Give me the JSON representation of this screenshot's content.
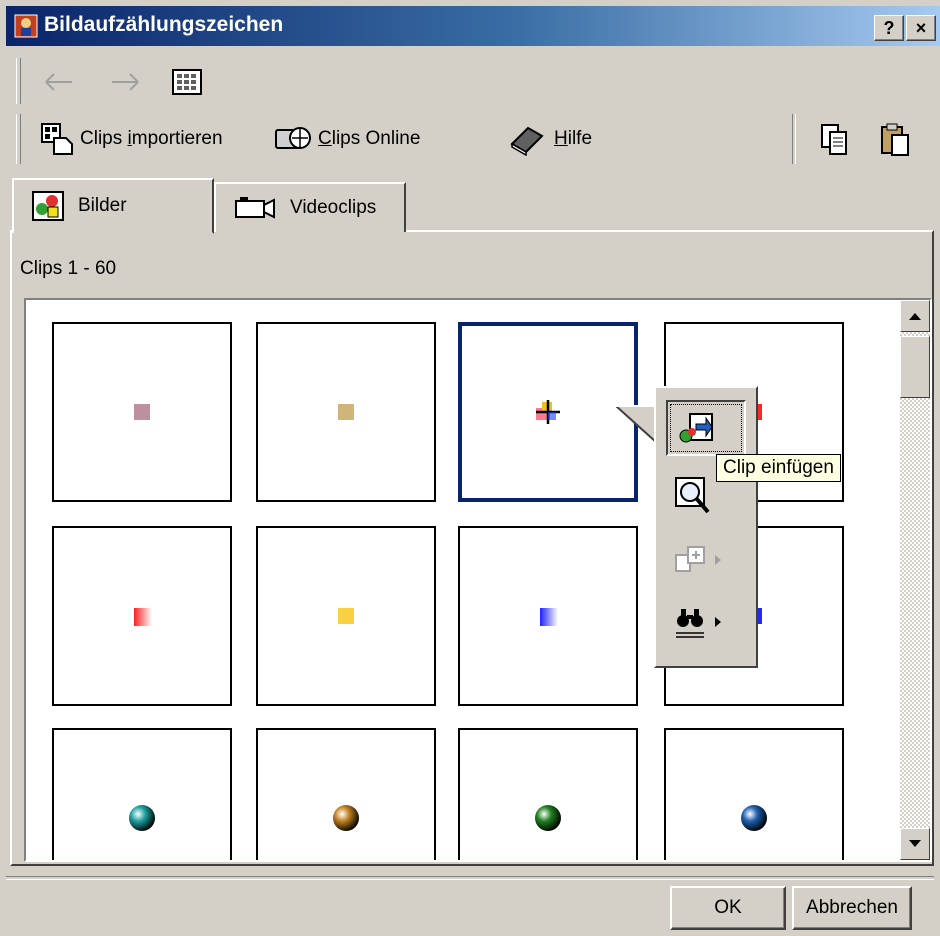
{
  "window": {
    "title": "Bildaufzählungszeichen",
    "help_btn": "?",
    "close_btn": "×"
  },
  "toolbar": {
    "back_icon": "back-arrow-icon",
    "forward_icon": "forward-arrow-icon",
    "view_icon": "thumbnail-view-icon",
    "import": {
      "prefix": "Clips ",
      "underlined": "i",
      "suffix": "mportieren"
    },
    "online": {
      "underlined": "C",
      "suffix": "lips Online"
    },
    "help": {
      "underlined": "H",
      "suffix": "ilfe"
    },
    "copy_icon": "copy-icon",
    "paste_icon": "paste-icon"
  },
  "tabs": [
    {
      "label": "Bilder",
      "icon": "pictures-icon",
      "active": true
    },
    {
      "label": "Videoclips",
      "icon": "camera-icon",
      "active": false
    }
  ],
  "clips_count": "Clips 1 - 60",
  "clips": [
    {
      "kind": "square",
      "color": "#b07c8c",
      "selected": false
    },
    {
      "kind": "square",
      "color": "#c8a860",
      "selected": false
    },
    {
      "kind": "cross",
      "color": "#ff4060",
      "selected": true
    },
    {
      "kind": "square",
      "color": "#ff0000",
      "selected": false
    },
    {
      "kind": "gradient",
      "color": "#ff2020",
      "selected": false
    },
    {
      "kind": "square",
      "color": "#f8c820",
      "selected": false
    },
    {
      "kind": "gradient",
      "color": "#2020ff",
      "selected": false
    },
    {
      "kind": "square",
      "color": "#0000ff",
      "selected": false
    },
    {
      "kind": "ball",
      "color": "#20a0a0",
      "selected": false
    },
    {
      "kind": "ball",
      "color": "#c08020",
      "selected": false
    },
    {
      "kind": "ball",
      "color": "#208020",
      "selected": false
    },
    {
      "kind": "ball",
      "color": "#2060b0",
      "selected": false
    }
  ],
  "popup": {
    "insert_icon": "insert-clip-icon",
    "preview_icon": "preview-clip-icon",
    "category_icon": "add-to-category-icon",
    "find_icon": "find-similar-icon",
    "tooltip": "Clip einfügen"
  },
  "buttons": {
    "ok": "OK",
    "cancel": "Abbrechen"
  }
}
